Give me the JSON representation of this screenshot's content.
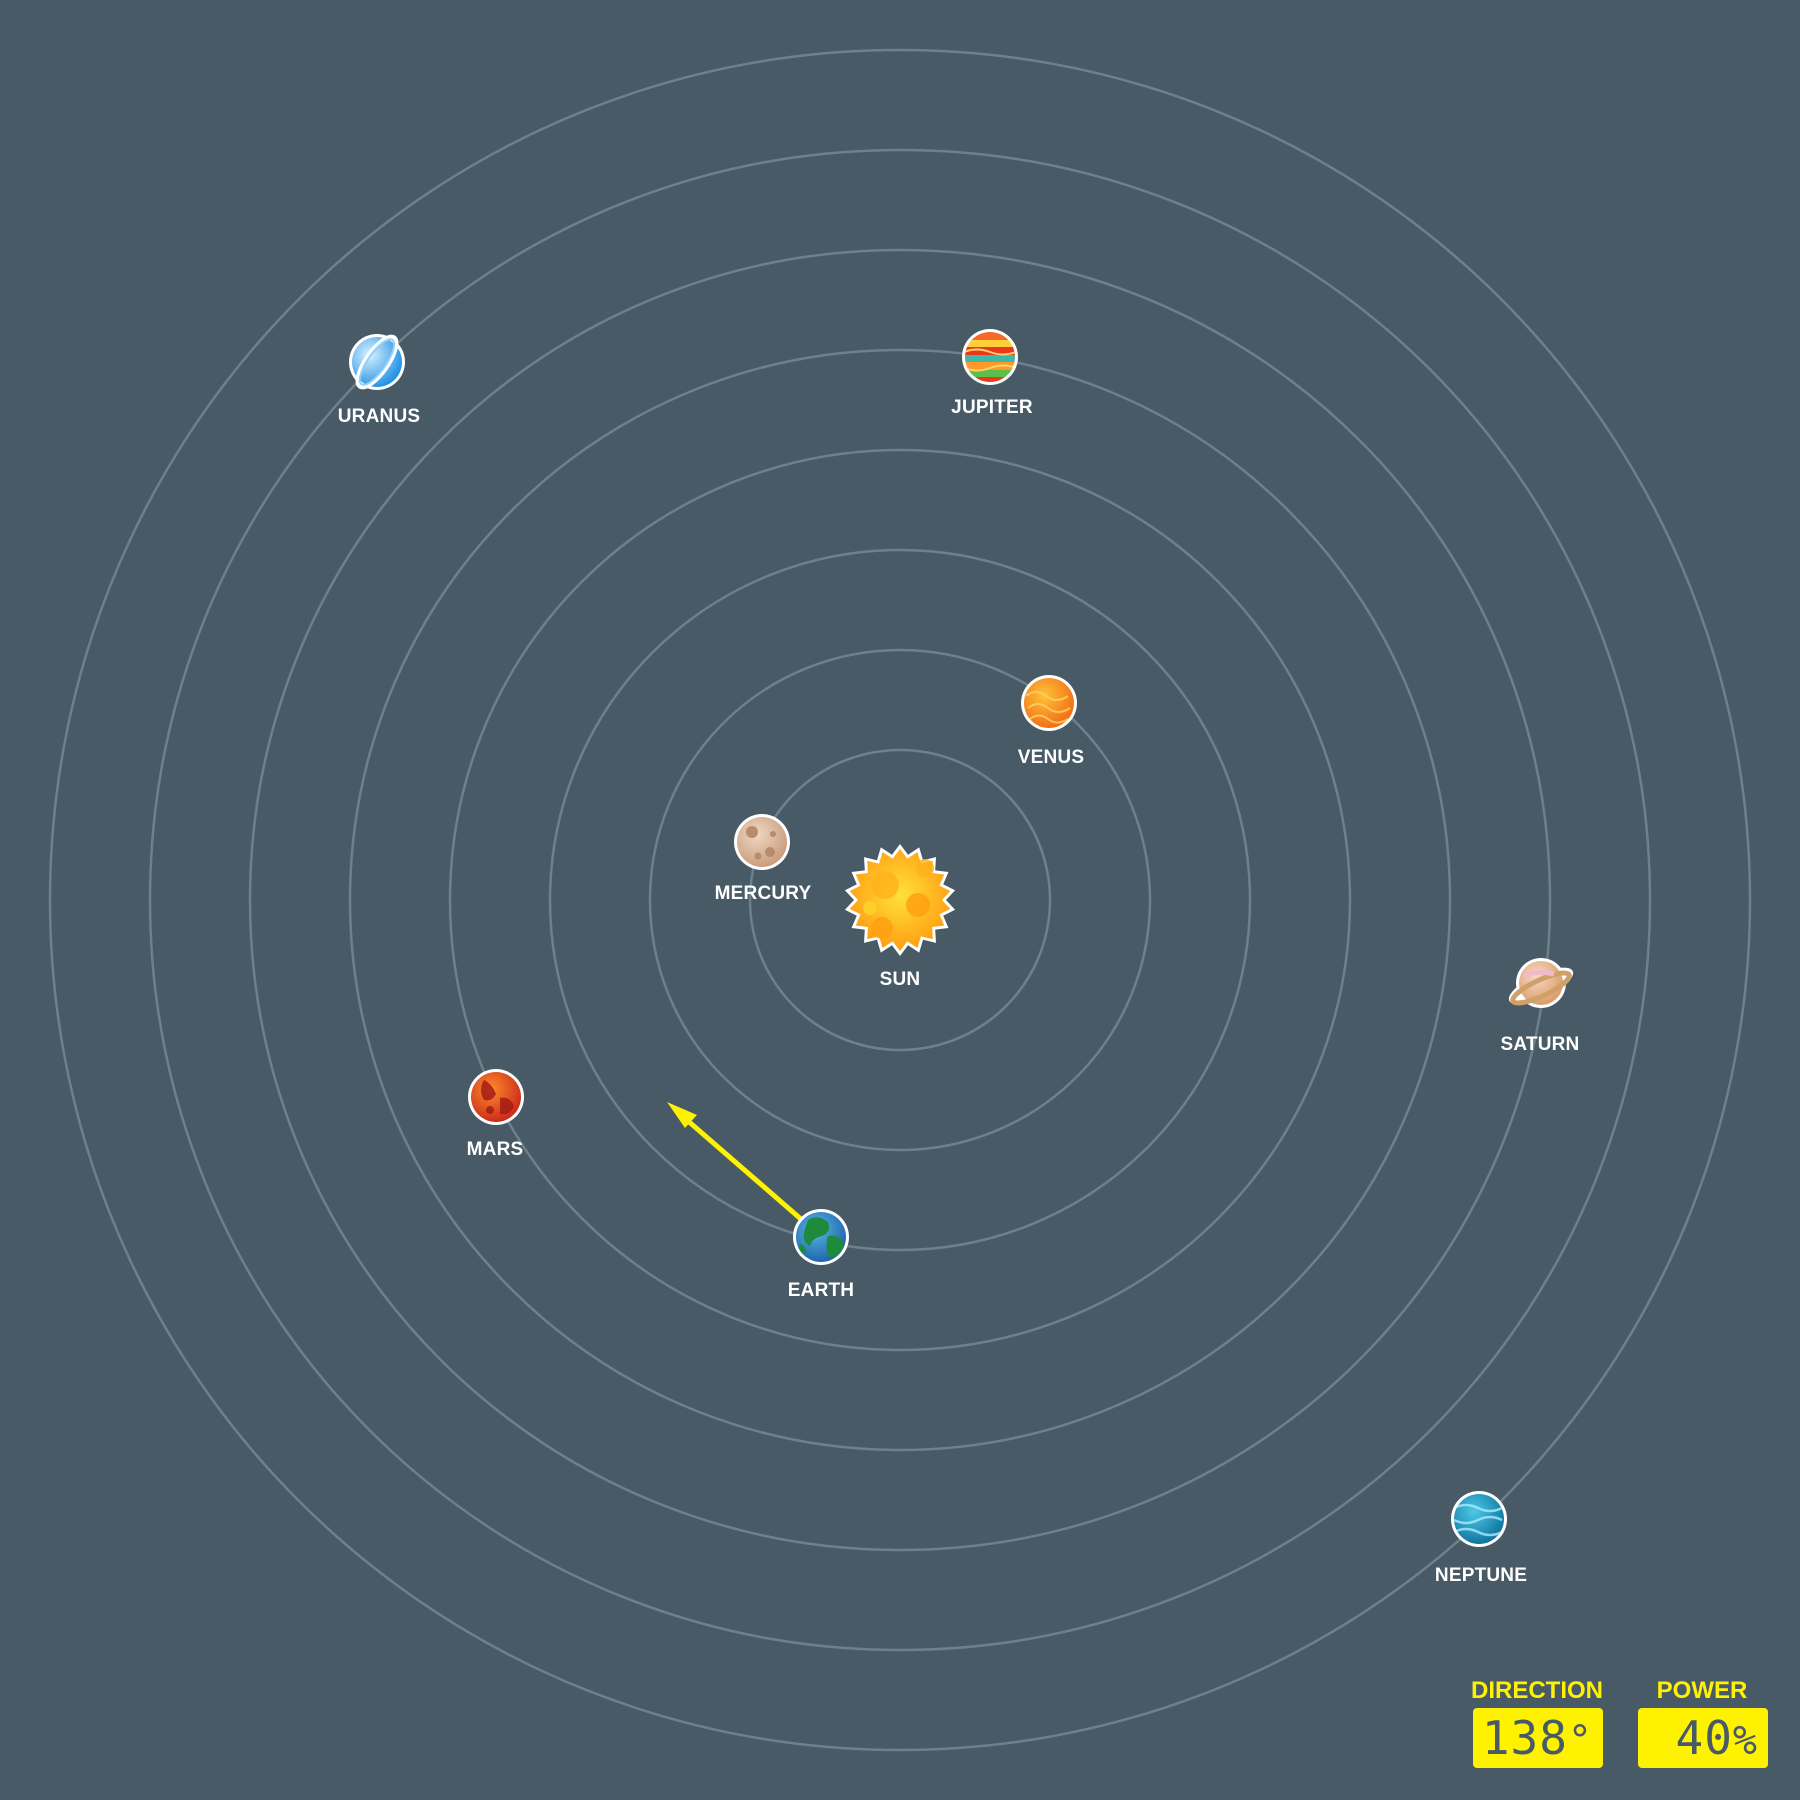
{
  "bodies": [
    {
      "key": "sun",
      "label": "SUN"
    },
    {
      "key": "mercury",
      "label": "MERCURY"
    },
    {
      "key": "venus",
      "label": "VENUS"
    },
    {
      "key": "earth",
      "label": "EARTH"
    },
    {
      "key": "mars",
      "label": "MARS"
    },
    {
      "key": "jupiter",
      "label": "JUPITER"
    },
    {
      "key": "saturn",
      "label": "SATURN"
    },
    {
      "key": "uranus",
      "label": "URANUS"
    },
    {
      "key": "neptune",
      "label": "NEPTUNE"
    }
  ],
  "hud": {
    "direction_title": "DIRECTION",
    "direction_value": "138",
    "direction_unit": "°",
    "power_title": "POWER",
    "power_value": "40",
    "power_unit": "%"
  },
  "colors": {
    "background": "#475a66",
    "orbit": "#6c818d",
    "arrow": "#fff200",
    "hud": "#fff200"
  },
  "icons": {
    "sun": "sun-icon",
    "mercury": "mercury-icon",
    "venus": "venus-icon",
    "earth": "earth-icon",
    "mars": "mars-icon",
    "jupiter": "jupiter-icon",
    "saturn": "saturn-icon",
    "uranus": "uranus-icon",
    "neptune": "neptune-icon"
  }
}
